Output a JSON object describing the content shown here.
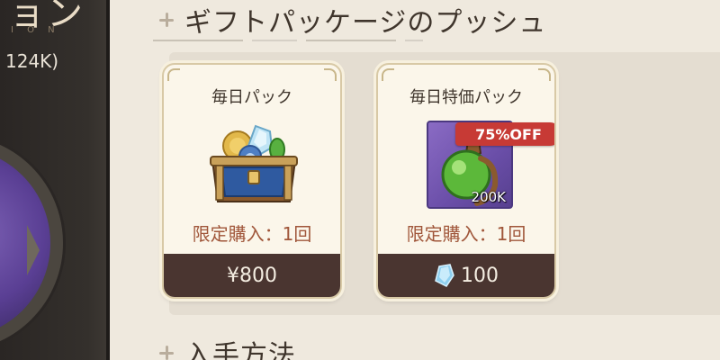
{
  "left_panel": {
    "title_partial": "ョン",
    "subtitle_partial": "I O N",
    "count_text": "124K)"
  },
  "sections": {
    "gift_push_title": "ギフトパッケージのプッシュ",
    "acquire_title": "入手方法"
  },
  "cards": [
    {
      "name": "毎日パック",
      "icon": "treasure-chest-icon",
      "limit": "限定購入：1回",
      "price": "¥800",
      "currency_icon": ""
    },
    {
      "name": "毎日特価パック",
      "icon": "green-potion-icon",
      "item_quantity": "200K",
      "discount": "75%OFF",
      "limit": "限定購入：1回",
      "price": "100",
      "currency_icon": "crystal-icon"
    }
  ],
  "colors": {
    "price_bar": "#4a3530",
    "limit_text": "#a0563a",
    "discount_badge": "#c73a35",
    "potion_frame": "#6a4ea8"
  }
}
